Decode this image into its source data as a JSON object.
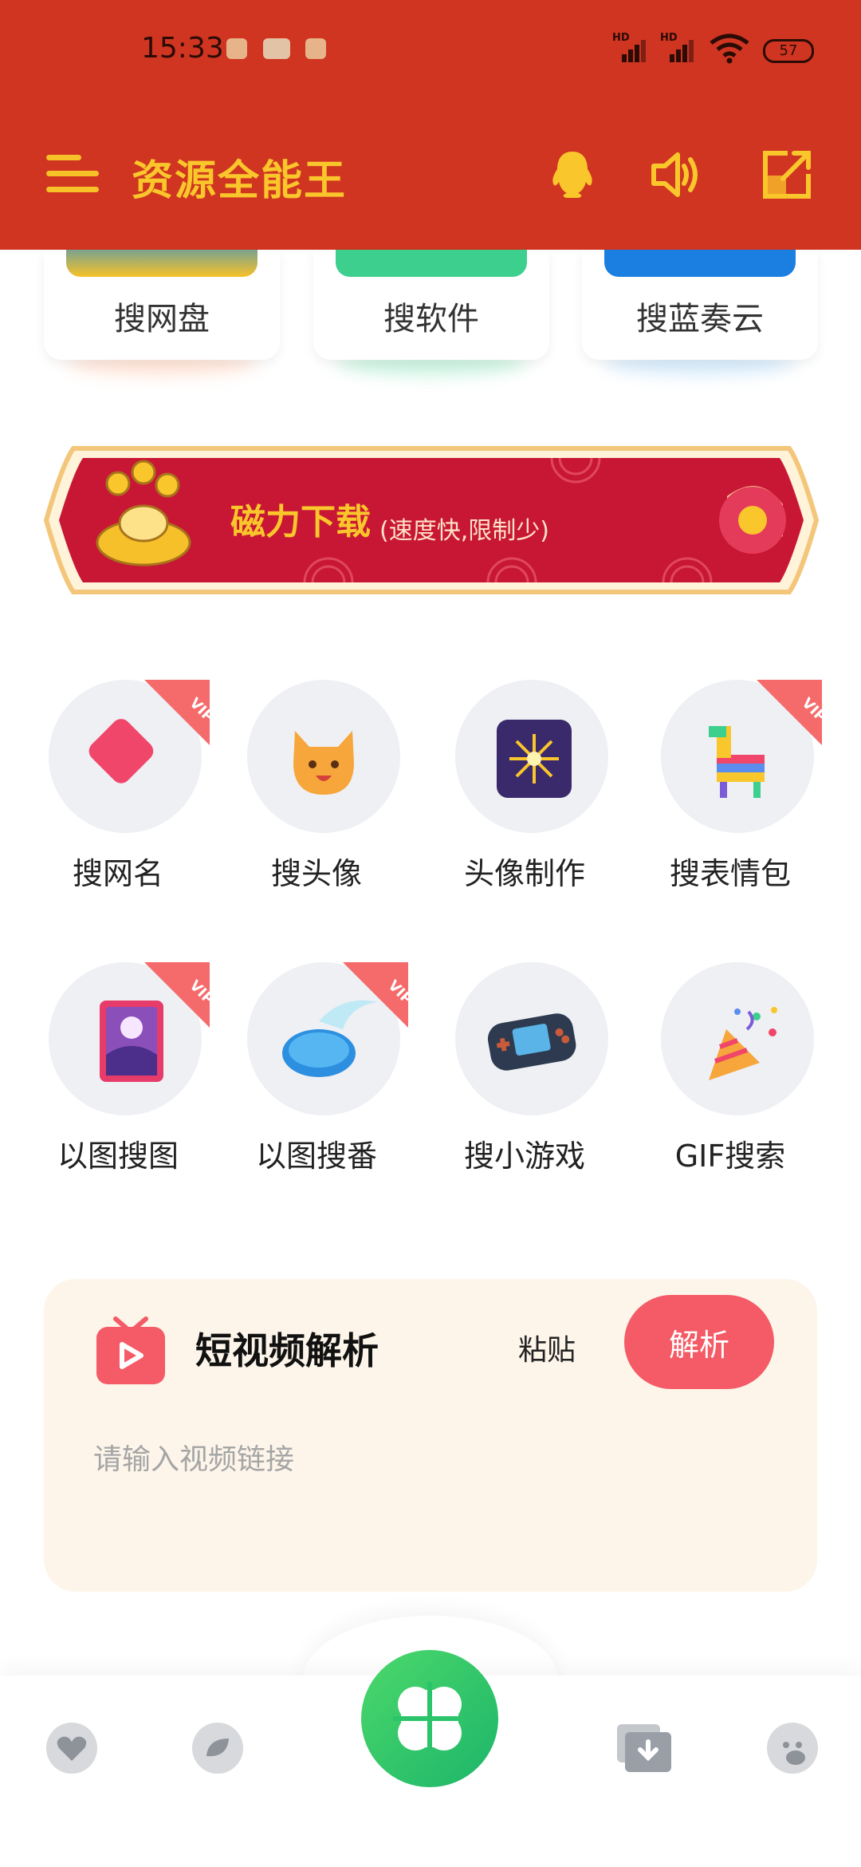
{
  "status_bar": {
    "time": "15:33",
    "signal_tag_1": "HD",
    "signal_tag_2": "HD",
    "battery": "57"
  },
  "app_bar": {
    "title": "资源全能王"
  },
  "source_cards": [
    {
      "label": "搜网盘"
    },
    {
      "label": "搜软件"
    },
    {
      "label": "搜蓝奏云"
    }
  ],
  "banner": {
    "title": "磁力下载",
    "subtitle": "(速度快,限制少)"
  },
  "grid": [
    {
      "label": "搜网名",
      "vip": true
    },
    {
      "label": "搜头像",
      "vip": false
    },
    {
      "label": "头像制作",
      "vip": false
    },
    {
      "label": "搜表情包",
      "vip": true
    },
    {
      "label": "以图搜图",
      "vip": true
    },
    {
      "label": "以图搜番",
      "vip": true
    },
    {
      "label": "搜小游戏",
      "vip": false
    },
    {
      "label": "GIF搜索",
      "vip": false
    }
  ],
  "vip_badge_text": "VIP",
  "short_video": {
    "title": "短视频解析",
    "paste_label": "粘贴",
    "parse_label": "解析",
    "input_placeholder": "请输入视频链接",
    "input_value": ""
  },
  "bottom_nav": {
    "icons": [
      "heart-icon",
      "leaf-icon",
      "clover-icon",
      "download-icon",
      "pig-icon"
    ]
  },
  "colors": {
    "header_bg": "#cf3521",
    "header_accent": "#f9c62b",
    "parse_button": "#f45b66",
    "panel_bg": "#fdf5ea"
  }
}
